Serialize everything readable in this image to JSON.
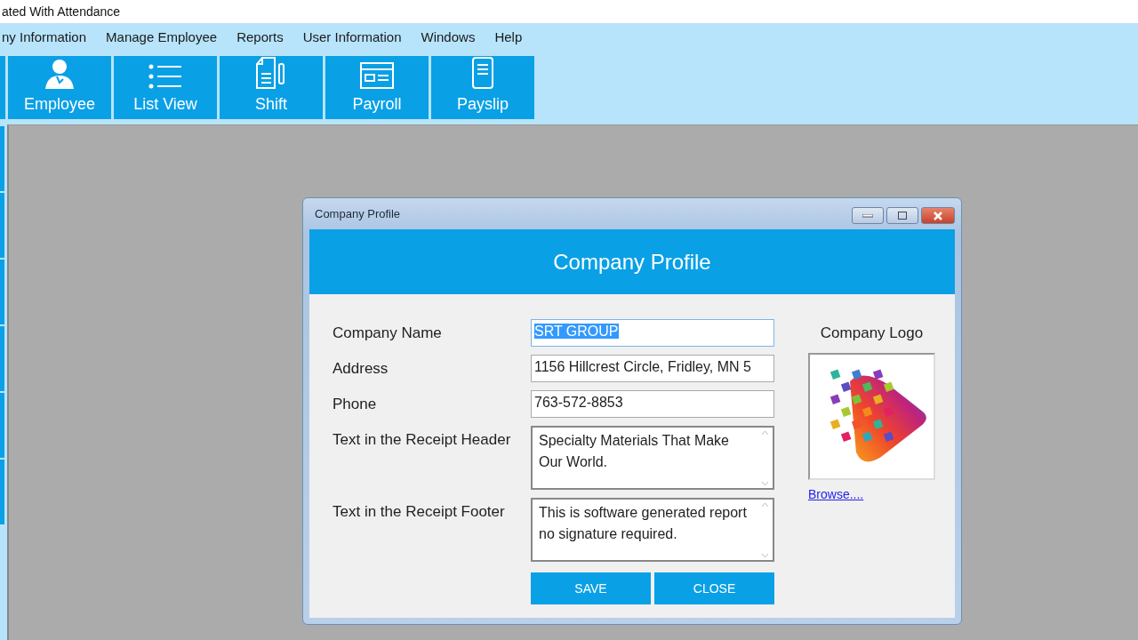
{
  "window": {
    "title": "ated With Attendance"
  },
  "menu": [
    "ny Information",
    "Manage Employee",
    "Reports",
    "User Information",
    "Windows",
    "Help"
  ],
  "toolbar": [
    {
      "label": "Employee"
    },
    {
      "label": "List View"
    },
    {
      "label": "Shift"
    },
    {
      "label": "Payroll"
    },
    {
      "label": "Payslip"
    }
  ],
  "dialog": {
    "title": "Company Profile",
    "header": "Company Profile",
    "fields": [
      {
        "label": "Company Name",
        "value": "SRT GROUP",
        "kind": "line",
        "text_selected": true
      },
      {
        "label": "Address",
        "value": "1156 Hillcrest Circle, Fridley, MN 5",
        "kind": "line",
        "text_selected": false
      },
      {
        "label": "Phone",
        "value": "763-572-8853",
        "kind": "line",
        "text_selected": false
      },
      {
        "label": "Text in the Receipt Header",
        "value": "Specialty Materials That Make Our World.",
        "kind": "multi",
        "text_selected": false
      },
      {
        "label": "Text in the Receipt Footer",
        "value": "This is software generated report no signature required.",
        "kind": "multi",
        "text_selected": false
      }
    ],
    "logo": {
      "label": "Company Logo",
      "link": "Browse...."
    },
    "buttons": [
      "SAVE",
      "CLOSE"
    ]
  }
}
